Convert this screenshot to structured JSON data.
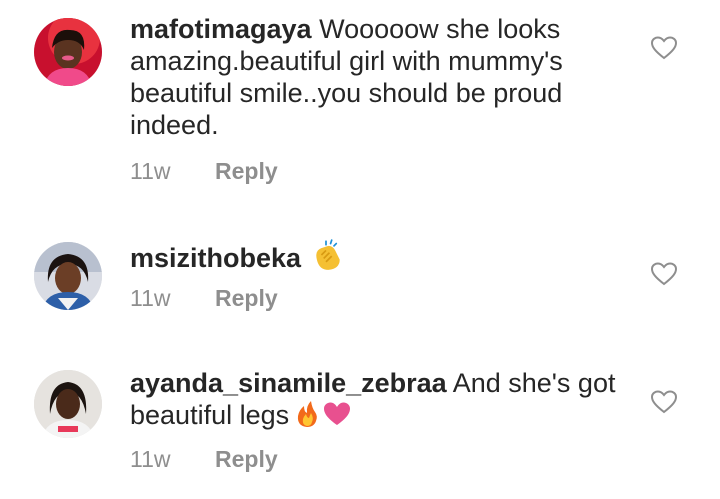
{
  "comments": [
    {
      "username": "mafotimagaya",
      "text": " Wooooow she looks amazing.beautiful girl with mummy's beautiful smile..you should be proud indeed.",
      "time": "11w",
      "reply_label": "Reply",
      "emojis": []
    },
    {
      "username": "msizithobeka",
      "text": " ",
      "time": "11w",
      "reply_label": "Reply",
      "emojis": [
        "clapping-hands-emoji"
      ]
    },
    {
      "username": "ayanda_sinamile_zebraa",
      "text": " And she's got beautiful legs",
      "time": "11w",
      "reply_label": "Reply",
      "emojis": [
        "fire-emoji",
        "pink-heart-emoji"
      ]
    }
  ],
  "icons": {
    "like": "heart-outline-icon"
  },
  "colors": {
    "text": "#262626",
    "secondary": "#8e8e8e",
    "background": "#ffffff"
  }
}
